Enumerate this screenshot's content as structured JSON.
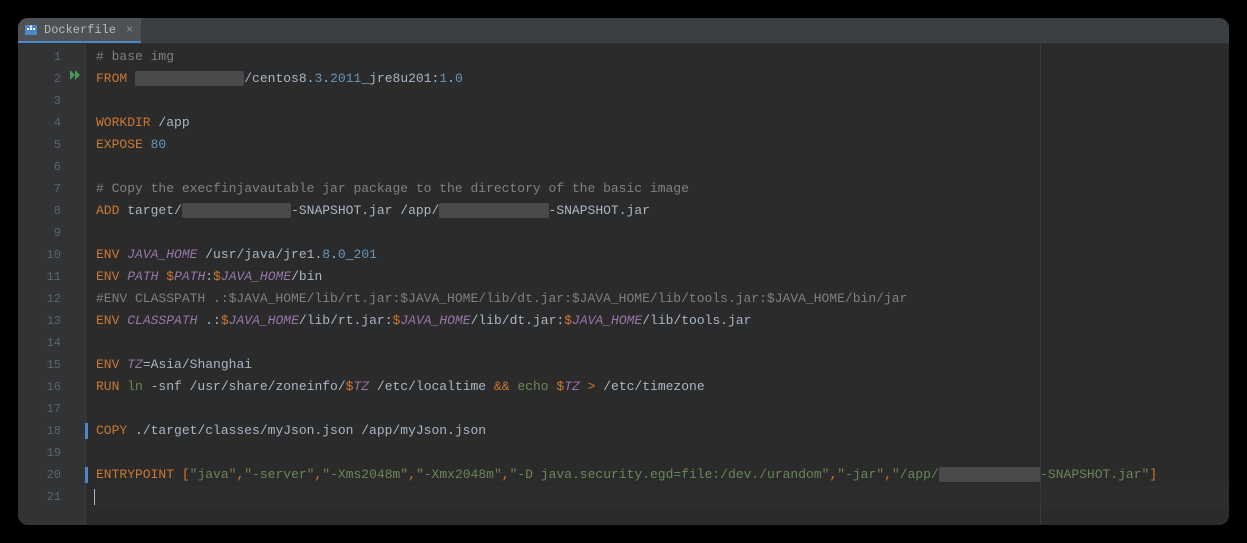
{
  "tab": {
    "label": "Dockerfile"
  },
  "gutter": {
    "lines": [
      "1",
      "2",
      "3",
      "4",
      "5",
      "6",
      "7",
      "8",
      "9",
      "10",
      "11",
      "12",
      "13",
      "14",
      "15",
      "16",
      "17",
      "18",
      "19",
      "20",
      "21"
    ],
    "runnable_line": 2
  },
  "code": {
    "lines": [
      {
        "t": "comment",
        "text": "# base img"
      },
      {
        "t": "from",
        "kw": "FROM",
        "pre": " ",
        "redact1": "              ",
        "mid": "/centos8",
        "dot1": ".",
        "n1": "3",
        "dot2": ".",
        "n2": "2011",
        "ul": "_jre8u201",
        "colon": ":",
        "v1": "1",
        "dot3": ".",
        "v2": "0"
      },
      {
        "t": "blank"
      },
      {
        "t": "workdir",
        "kw": "WORKDIR",
        "path": " /app"
      },
      {
        "t": "expose",
        "kw": "EXPOSE",
        "sp": " ",
        "port": "80"
      },
      {
        "t": "blank"
      },
      {
        "t": "comment",
        "text": "# Copy the execfinjavautable jar package to the directory of the basic image"
      },
      {
        "t": "add",
        "kw": "ADD",
        "p1": " target",
        "s1": "/",
        "redact1": "              ",
        "p2": "-SNAPSHOT.jar /app",
        "s2": "/",
        "redact2": "              ",
        "p3": "-SNAPSHOT.jar"
      },
      {
        "t": "blank"
      },
      {
        "t": "env_javahome",
        "kw": "ENV",
        "sp": " ",
        "var": "JAVA_HOME",
        "path1": " /usr/java/jre1",
        "dot": ".",
        "n1": "8",
        "dot2": ".",
        "n2": "0",
        "ul": "_",
        "n3": "201"
      },
      {
        "t": "env_path",
        "kw": "ENV",
        "sp": " ",
        "var": "PATH",
        "sp2": " ",
        "d1": "$",
        "ref1": "PATH",
        "colon": ":",
        "d2": "$",
        "ref2": "JAVA_HOME",
        "rest": "/bin"
      },
      {
        "t": "comment",
        "text": "#ENV CLASSPATH .:$JAVA_HOME/lib/rt.jar:$JAVA_HOME/lib/dt.jar:$JAVA_HOME/lib/tools.jar:$JAVA_HOME/bin/jar"
      },
      {
        "t": "env_classpath",
        "kw": "ENV",
        "sp": " ",
        "var": "CLASSPATH",
        "p0": " .",
        "c0": ":",
        "d1": "$",
        "r1": "JAVA_HOME",
        "p1": "/lib/rt.jar",
        "c1": ":",
        "d2": "$",
        "r2": "JAVA_HOME",
        "p2": "/lib/dt.jar",
        "c2": ":",
        "d3": "$",
        "r3": "JAVA_HOME",
        "p3": "/lib/tools.jar"
      },
      {
        "t": "blank"
      },
      {
        "t": "env_tz",
        "kw": "ENV",
        "sp": " ",
        "var": "TZ",
        "eq": "=",
        "val": "Asia/Shanghai"
      },
      {
        "t": "run",
        "kw": "RUN",
        "sp": " ",
        "cmd": "ln",
        "args1": " -snf /usr/share/zoneinfo/",
        "d1": "$",
        "r1": "TZ",
        "args2": " /etc/localtime ",
        "and": "&&",
        "sp2": " ",
        "echo": "echo",
        "sp3": " ",
        "d2": "$",
        "r2": "TZ",
        "sp4": " ",
        "gt": ">",
        "args3": " /etc/timezone"
      },
      {
        "t": "blank"
      },
      {
        "t": "copy",
        "kw": "COPY",
        "marker": true,
        "p": " ./target/classes/myJson.json /app/myJson.json"
      },
      {
        "t": "blank"
      },
      {
        "t": "entrypoint",
        "kw": "ENTRYPOINT",
        "marker": true,
        "sp": " ",
        "lb": "[",
        "s1": "\"java\"",
        "c1": ",",
        "s2": "\"-server\"",
        "c2": ",",
        "s3": "\"-Xms2048m\"",
        "c3": ",",
        "s4": "\"-Xmx2048m\"",
        "c4": ",",
        "s5": "\"-D java.security.egd=file:/dev./urandom\"",
        "c5": ",",
        "s6": "\"-jar\"",
        "c6": ",",
        "s7a": "\"/app/",
        "redact": "             ",
        "s7b": "-SNAPSHOT.jar\"",
        "rb": "]"
      },
      {
        "t": "caret"
      }
    ]
  }
}
